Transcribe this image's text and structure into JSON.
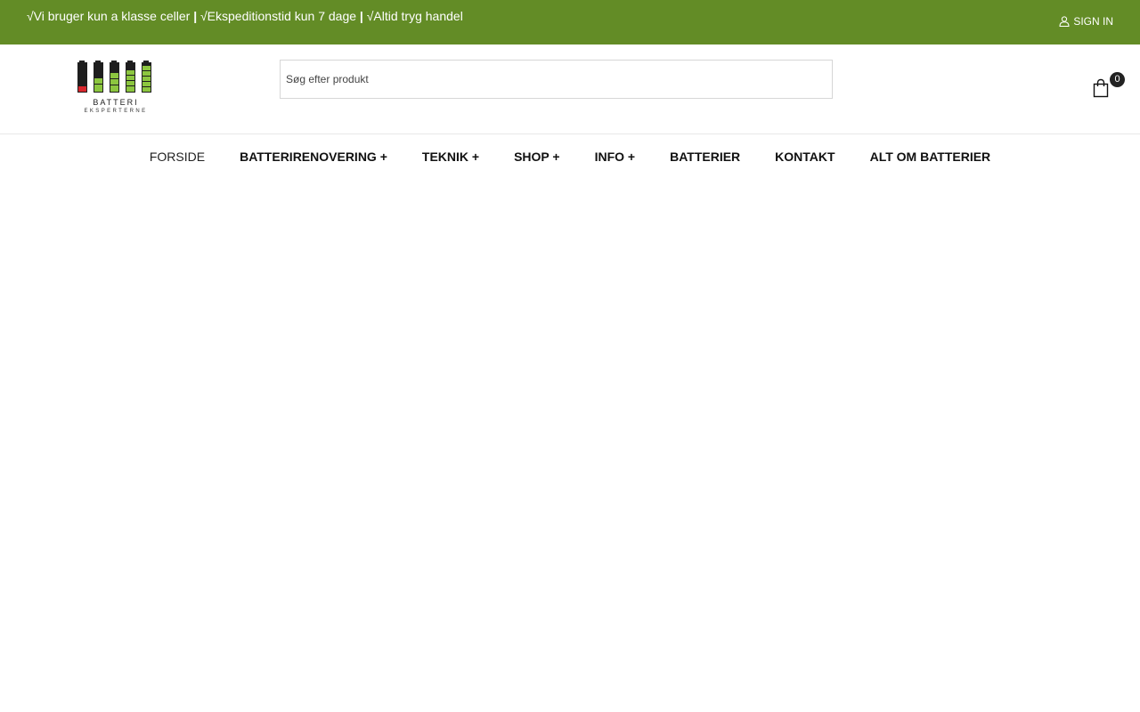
{
  "topbar": {
    "msg1": "√Vi bruger kun a klasse celler",
    "sep": "|",
    "msg2": "√Ekspeditionstid kun 7 dage",
    "msg3": "√Altid tryg handel",
    "signin_label": "SIGN IN",
    "bg_color": "#638c26"
  },
  "header": {
    "logo_line1": "BATTERI",
    "logo_line2": "EKSPERTERNE",
    "search_placeholder": "Søg efter produkt",
    "cart_count": "0"
  },
  "nav": {
    "items": [
      {
        "label": "FORSIDE"
      },
      {
        "label": "BATTERIRENOVERING +"
      },
      {
        "label": "TEKNIK +"
      },
      {
        "label": "SHOP +"
      },
      {
        "label": "INFO +"
      },
      {
        "label": "BATTERIER"
      },
      {
        "label": "KONTAKT"
      },
      {
        "label": "ALT OM BATTERIER"
      }
    ]
  },
  "icons": {
    "signin": "user-icon",
    "cart": "shopping-bag-icon"
  }
}
